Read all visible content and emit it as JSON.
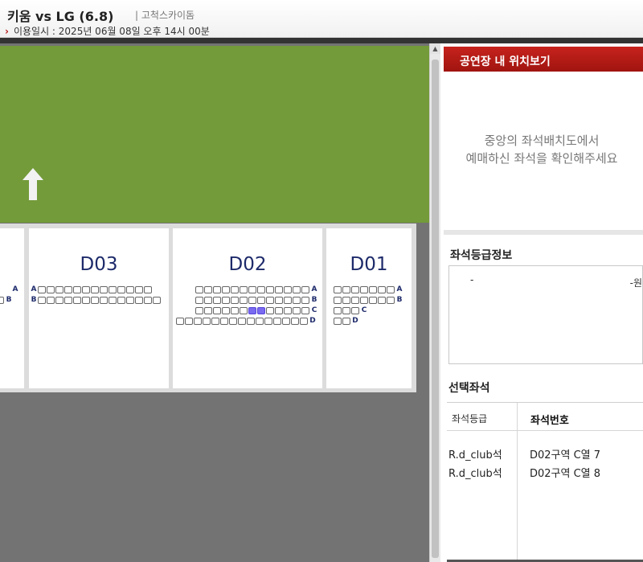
{
  "header": {
    "title": "키움 vs LG (6.8)",
    "venue": "| 고척스카이돔",
    "date_label": "이용일시 : 2025년 06월 08일 오후 14시 00분"
  },
  "colors": {
    "field": "#739b3a",
    "panel_header": "#b81c16",
    "selected_seat": "#7a6af0",
    "block_label": "#1d2a6a"
  },
  "map": {
    "direction_icon": "up-arrow-icon",
    "blocks": [
      {
        "label": "",
        "rows": [
          {
            "label": "A",
            "side": "right"
          },
          {
            "label": "B",
            "side": "right"
          }
        ]
      },
      {
        "label": "D03",
        "rows": [
          {
            "label": "A",
            "side": "left"
          },
          {
            "label": "B",
            "side": "left"
          }
        ]
      },
      {
        "label": "D02",
        "rows": [
          {
            "label": "A",
            "side": "right"
          },
          {
            "label": "B",
            "side": "right"
          },
          {
            "label": "C",
            "side": "right",
            "selected_seats": [
              7,
              8
            ]
          },
          {
            "label": "D",
            "side": "right"
          }
        ]
      },
      {
        "label": "D01",
        "rows": [
          {
            "label": "A",
            "side": "right"
          },
          {
            "label": "B",
            "side": "right"
          },
          {
            "label": "C",
            "side": "right"
          },
          {
            "label": "D",
            "side": "right"
          }
        ]
      }
    ]
  },
  "panel": {
    "header": "공연장 내 위치보기",
    "message_line1": "중앙의 좌석배치도에서",
    "message_line2": "예매하신 좌석을 확인해주세요",
    "grade_info_title": "좌석등급정보",
    "grade_name": "-",
    "grade_price": "-원",
    "selected_title": "선택좌석",
    "col_grade": "좌석등급",
    "col_number": "좌석번호",
    "selected": [
      {
        "grade": "R.d_club석",
        "number": "D02구역 C열 7"
      },
      {
        "grade": "R.d_club석",
        "number": "D02구역 C열 8"
      }
    ]
  }
}
